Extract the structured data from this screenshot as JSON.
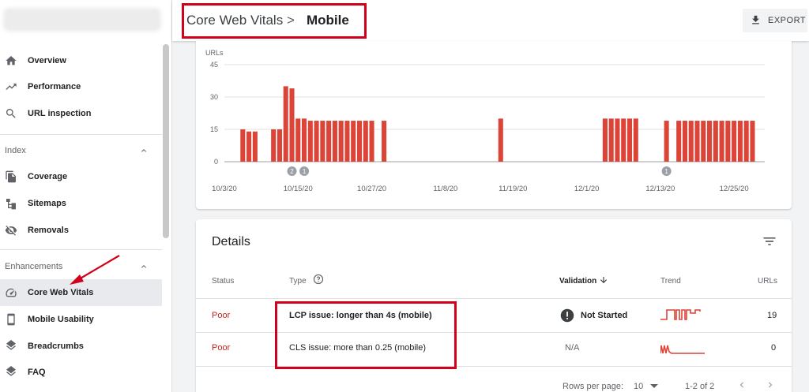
{
  "sidebar": {
    "items_top": [
      {
        "label": "Overview",
        "icon": "home-icon"
      },
      {
        "label": "Performance",
        "icon": "trending-up-icon"
      },
      {
        "label": "URL inspection",
        "icon": "search-icon"
      }
    ],
    "index_section": {
      "label": "Index"
    },
    "index_items": [
      {
        "label": "Coverage",
        "icon": "file-copy-icon"
      },
      {
        "label": "Sitemaps",
        "icon": "sitemap-icon"
      },
      {
        "label": "Removals",
        "icon": "eye-off-icon"
      }
    ],
    "enhancements_section": {
      "label": "Enhancements"
    },
    "enh_items": [
      {
        "label": "Core Web Vitals",
        "icon": "speed-gauge-icon"
      },
      {
        "label": "Mobile Usability",
        "icon": "smartphone-icon"
      },
      {
        "label": "Breadcrumbs",
        "icon": "layers-icon"
      },
      {
        "label": "FAQ",
        "icon": "layers-icon"
      }
    ]
  },
  "header": {
    "breadcrumb_parent": "Core Web Vitals",
    "breadcrumb_sep": ">",
    "breadcrumb_current": "Mobile",
    "export_label": "EXPORT"
  },
  "chart_data": {
    "type": "bar",
    "ylabel": "URLs",
    "yticks": [
      0,
      15,
      30,
      45
    ],
    "ylim": [
      0,
      45
    ],
    "xtick_labels": [
      "10/3/20",
      "10/15/20",
      "10/27/20",
      "11/8/20",
      "11/19/20",
      "12/1/20",
      "12/13/20",
      "12/25/20"
    ],
    "x_start": "2020-10-03",
    "x_end": "2020-12-30",
    "grid": true,
    "bar_color": "#db4437",
    "bars": [
      {
        "x": "2020-10-06",
        "y": 15
      },
      {
        "x": "2020-10-07",
        "y": 14
      },
      {
        "x": "2020-10-08",
        "y": 14
      },
      {
        "x": "2020-10-11",
        "y": 15
      },
      {
        "x": "2020-10-12",
        "y": 15
      },
      {
        "x": "2020-10-13",
        "y": 35
      },
      {
        "x": "2020-10-14",
        "y": 34
      },
      {
        "x": "2020-10-15",
        "y": 20
      },
      {
        "x": "2020-10-16",
        "y": 20
      },
      {
        "x": "2020-10-17",
        "y": 19
      },
      {
        "x": "2020-10-18",
        "y": 19
      },
      {
        "x": "2020-10-19",
        "y": 19
      },
      {
        "x": "2020-10-20",
        "y": 19
      },
      {
        "x": "2020-10-21",
        "y": 19
      },
      {
        "x": "2020-10-22",
        "y": 19
      },
      {
        "x": "2020-10-23",
        "y": 19
      },
      {
        "x": "2020-10-24",
        "y": 19
      },
      {
        "x": "2020-10-25",
        "y": 19
      },
      {
        "x": "2020-10-26",
        "y": 19
      },
      {
        "x": "2020-10-27",
        "y": 19
      },
      {
        "x": "2020-10-29",
        "y": 19
      },
      {
        "x": "2020-11-17",
        "y": 20
      },
      {
        "x": "2020-12-04",
        "y": 20
      },
      {
        "x": "2020-12-05",
        "y": 20
      },
      {
        "x": "2020-12-06",
        "y": 20
      },
      {
        "x": "2020-12-07",
        "y": 20
      },
      {
        "x": "2020-12-08",
        "y": 20
      },
      {
        "x": "2020-12-09",
        "y": 20
      },
      {
        "x": "2020-12-14",
        "y": 19
      },
      {
        "x": "2020-12-16",
        "y": 19
      },
      {
        "x": "2020-12-17",
        "y": 19
      },
      {
        "x": "2020-12-18",
        "y": 19
      },
      {
        "x": "2020-12-19",
        "y": 19
      },
      {
        "x": "2020-12-20",
        "y": 19
      },
      {
        "x": "2020-12-21",
        "y": 19
      },
      {
        "x": "2020-12-22",
        "y": 19
      },
      {
        "x": "2020-12-23",
        "y": 19
      },
      {
        "x": "2020-12-24",
        "y": 19
      },
      {
        "x": "2020-12-25",
        "y": 19
      },
      {
        "x": "2020-12-26",
        "y": 19
      },
      {
        "x": "2020-12-27",
        "y": 19
      },
      {
        "x": "2020-12-28",
        "y": 19
      }
    ],
    "annotations": [
      {
        "x": "2020-10-14",
        "label": "2"
      },
      {
        "x": "2020-10-16",
        "label": "1"
      },
      {
        "x": "2020-12-14",
        "label": "1"
      }
    ]
  },
  "details": {
    "title": "Details",
    "columns": {
      "status": "Status",
      "type": "Type",
      "validation": "Validation",
      "trend": "Trend",
      "urls": "URLs"
    },
    "rows": [
      {
        "status": "Poor",
        "type": "LCP issue: longer than 4s (mobile)",
        "validation": "Not Started",
        "validation_icon": "!",
        "urls": "19"
      },
      {
        "status": "Poor",
        "type": "CLS issue: more than 0.25 (mobile)",
        "validation": "N/A",
        "urls": "0"
      }
    ],
    "footer": {
      "rows_per_page_label": "Rows per page:",
      "rows_per_page_value": "10",
      "range": "1-2 of 2"
    }
  },
  "colors": {
    "accent_red": "#db4437",
    "poor": "#c5221f",
    "annotation_box": "#d0021b"
  }
}
